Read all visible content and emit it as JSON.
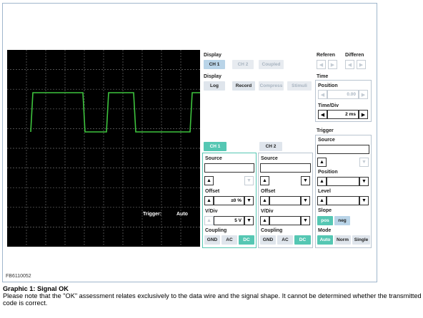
{
  "figure_id": "FB6110052",
  "scope": {
    "trigger_label": "Trigger:",
    "trigger_value": "Auto",
    "trace_color": "#3ec43e"
  },
  "display": {
    "label": "Display",
    "ch1": "CH 1",
    "ch2": "CH 2",
    "coupled": "Coupled",
    "label2": "Display",
    "log": "Log",
    "record": "Record",
    "compress": "Compress",
    "stimuli": "Stimuli"
  },
  "reference": {
    "label": "Referen",
    "diff_label": "Differen"
  },
  "time": {
    "label": "Time",
    "position_label": "Position",
    "position_value": "0.00",
    "timediv_label": "Time/Div",
    "timediv_value": "2 ms"
  },
  "channels": {
    "ch1": {
      "tab": "CH 1",
      "source_label": "Source",
      "offset_label": "Offset",
      "offset_value": "±0 %",
      "vdiv_label": "V/Div",
      "vdiv_value": "5 V",
      "coupling_label": "Coupling",
      "gnd": "GND",
      "ac": "AC",
      "dc": "DC"
    },
    "ch2": {
      "tab": "CH 2",
      "source_label": "Source",
      "offset_label": "Offset",
      "vdiv_label": "V/Div",
      "coupling_label": "Coupling",
      "gnd": "GND",
      "ac": "AC",
      "dc": "DC"
    }
  },
  "trigger": {
    "label": "Trigger",
    "source_label": "Source",
    "position_label": "Position",
    "level_label": "Level",
    "slope_label": "Slope",
    "pos": "pos",
    "neg": "neg",
    "mode_label": "Mode",
    "auto": "Auto",
    "norm": "Norm",
    "single": "Single"
  },
  "caption": {
    "title": "Graphic 1: Signal OK",
    "text": "Please note that the \"OK\" assessment relates exclusively to the data wire and the signal shape. It cannot be determined whether the transmitted code is correct."
  },
  "colors": {
    "accent": "#55c7b3",
    "selected": "#b9d4e8",
    "screen": "#000000"
  }
}
